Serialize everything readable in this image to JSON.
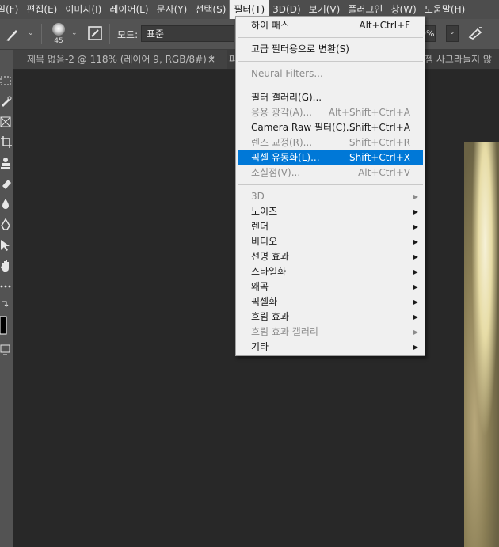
{
  "menubar": {
    "items": [
      "일(F)",
      "편집(E)",
      "이미지(I)",
      "레이어(L)",
      "문자(Y)",
      "선택(S)",
      "필터(T)",
      "3D(D)",
      "보기(V)",
      "플러그인",
      "창(W)",
      "도움말(H)"
    ]
  },
  "options": {
    "brush_size": "45",
    "mode_label": "모드:",
    "mode_value": "표준",
    "flow_value": "0%"
  },
  "tabs": {
    "active": "제목 없음-2 @ 118% (레이어 9, RGB/8#) *",
    "close": "×",
    "partial_left": "피",
    "partial_right": "쳄 사그라들지 않"
  },
  "filter_menu": {
    "items": [
      {
        "label": "하이 패스",
        "shortcut": "Alt+Ctrl+F",
        "disabled": false,
        "submenu": false,
        "highlighted": false
      },
      {
        "label": "고급 필터용으로 변환(S)",
        "shortcut": "",
        "disabled": false,
        "submenu": false,
        "highlighted": false
      },
      {
        "label": "Neural Filters...",
        "shortcut": "",
        "disabled": true,
        "submenu": false,
        "highlighted": false
      },
      {
        "label": "필터 갤러리(G)...",
        "shortcut": "",
        "disabled": false,
        "submenu": false,
        "highlighted": false
      },
      {
        "label": "응용 광각(A)...",
        "shortcut": "Alt+Shift+Ctrl+A",
        "disabled": true,
        "submenu": false,
        "highlighted": false
      },
      {
        "label": "Camera Raw 필터(C)...",
        "shortcut": "Shift+Ctrl+A",
        "disabled": false,
        "submenu": false,
        "highlighted": false
      },
      {
        "label": "렌즈 교정(R)...",
        "shortcut": "Shift+Ctrl+R",
        "disabled": true,
        "submenu": false,
        "highlighted": false
      },
      {
        "label": "픽셀 유동화(L)...",
        "shortcut": "Shift+Ctrl+X",
        "disabled": false,
        "submenu": false,
        "highlighted": true
      },
      {
        "label": "소실점(V)...",
        "shortcut": "Alt+Ctrl+V",
        "disabled": true,
        "submenu": false,
        "highlighted": false
      },
      {
        "label": "3D",
        "shortcut": "",
        "disabled": true,
        "submenu": true,
        "highlighted": false
      },
      {
        "label": "노이즈",
        "shortcut": "",
        "disabled": false,
        "submenu": true,
        "highlighted": false
      },
      {
        "label": "렌더",
        "shortcut": "",
        "disabled": false,
        "submenu": true,
        "highlighted": false
      },
      {
        "label": "비디오",
        "shortcut": "",
        "disabled": false,
        "submenu": true,
        "highlighted": false
      },
      {
        "label": "선명 효과",
        "shortcut": "",
        "disabled": false,
        "submenu": true,
        "highlighted": false
      },
      {
        "label": "스타일화",
        "shortcut": "",
        "disabled": false,
        "submenu": true,
        "highlighted": false
      },
      {
        "label": "왜곡",
        "shortcut": "",
        "disabled": false,
        "submenu": true,
        "highlighted": false
      },
      {
        "label": "픽셀화",
        "shortcut": "",
        "disabled": false,
        "submenu": true,
        "highlighted": false
      },
      {
        "label": "흐림 효과",
        "shortcut": "",
        "disabled": false,
        "submenu": true,
        "highlighted": false
      },
      {
        "label": "흐림 효과 갤러리",
        "shortcut": "",
        "disabled": true,
        "submenu": true,
        "highlighted": false
      },
      {
        "label": "기타",
        "shortcut": "",
        "disabled": false,
        "submenu": true,
        "highlighted": false
      }
    ]
  },
  "colors": {
    "highlight": "#0078d7",
    "menubar_bg": "#4d4d4d",
    "workspace_bg": "#282828"
  }
}
